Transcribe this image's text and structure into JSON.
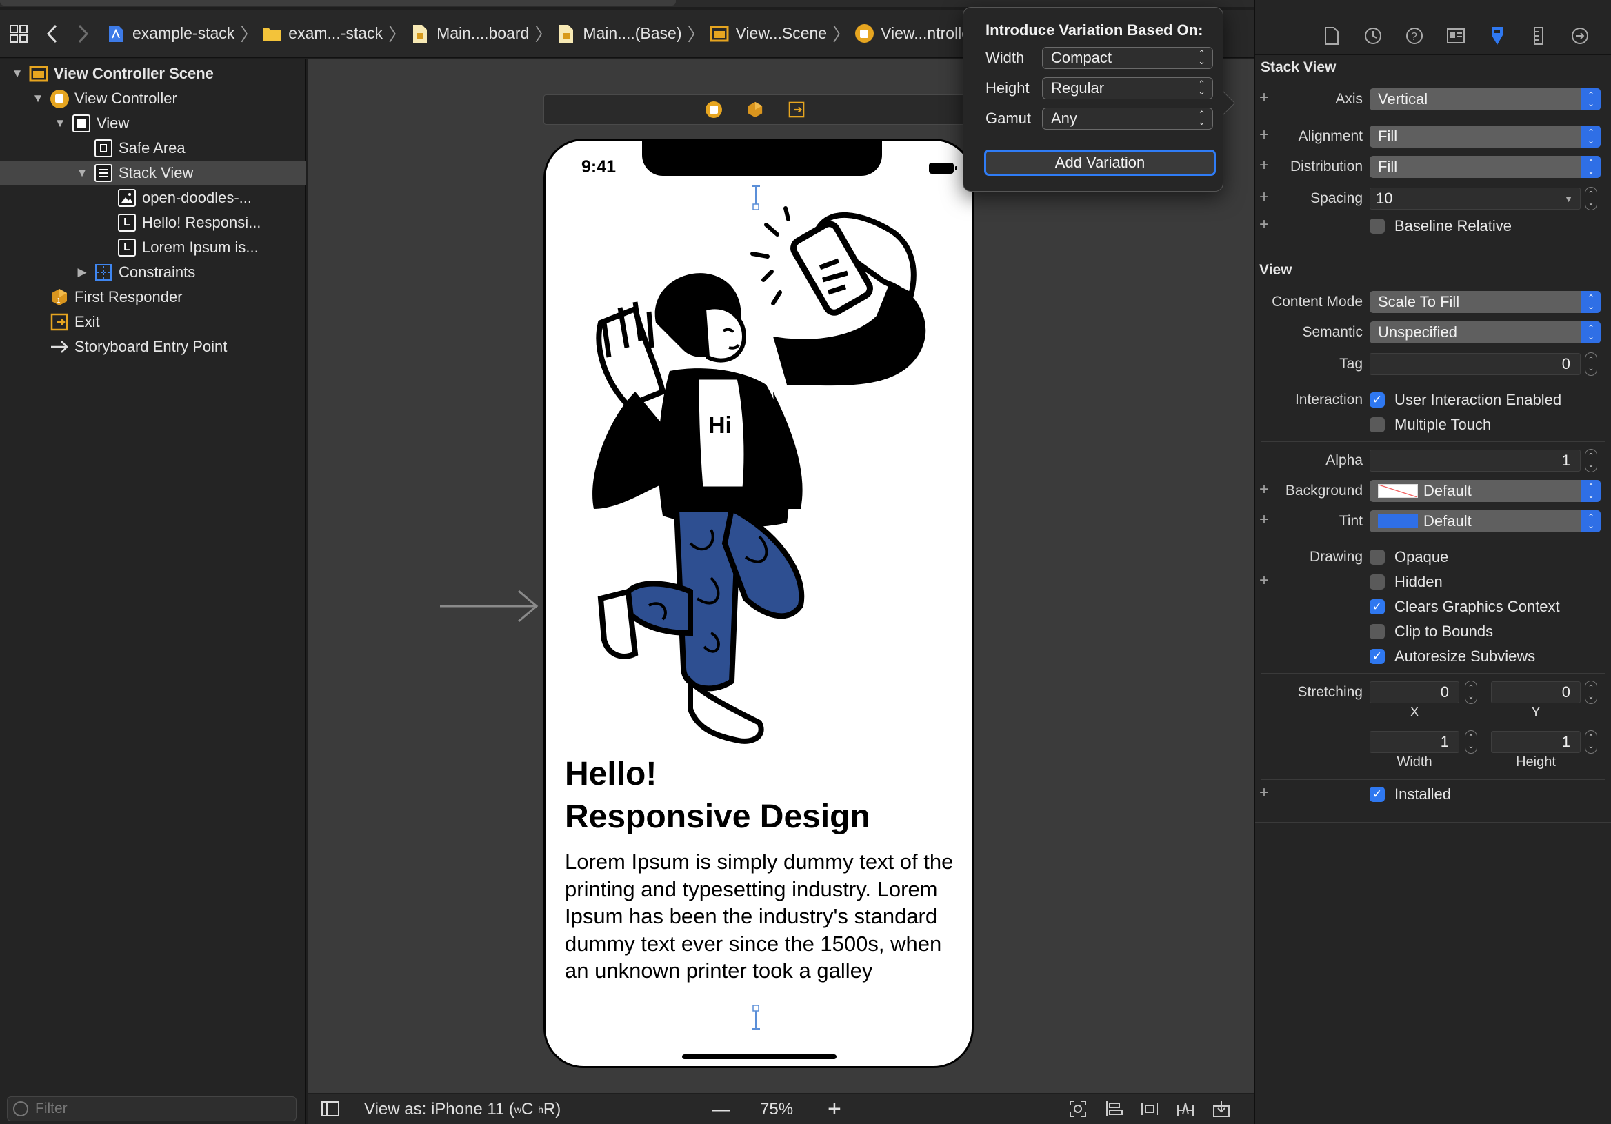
{
  "jumpbar": {
    "crumbs": [
      "example-stack",
      "exam...-stack",
      "Main....board",
      "Main....(Base)",
      "View...Scene",
      "View...ntroller"
    ]
  },
  "navigator": {
    "rows": [
      {
        "label": "View Controller Scene",
        "icon": "scene-icon"
      },
      {
        "label": "View Controller",
        "icon": "view-controller-icon"
      },
      {
        "label": "View",
        "icon": "view-icon"
      },
      {
        "label": "Safe Area",
        "icon": "safe-area-icon"
      },
      {
        "label": "Stack View",
        "icon": "stack-view-icon"
      },
      {
        "label": "open-doodles-...",
        "icon": "image-view-icon"
      },
      {
        "label": "Hello! Responsi...",
        "icon": "label-icon"
      },
      {
        "label": "Lorem Ipsum is...",
        "icon": "label-icon"
      },
      {
        "label": "Constraints",
        "icon": "constraints-icon"
      },
      {
        "label": "First Responder",
        "icon": "first-responder-icon"
      },
      {
        "label": "Exit",
        "icon": "exit-icon"
      },
      {
        "label": "Storyboard Entry Point",
        "icon": "arrow-right-icon"
      }
    ],
    "label_glyph": "L",
    "filter_placeholder": "Filter"
  },
  "phone": {
    "time": "9:41",
    "shirt_text": "Hi",
    "title_line1": "Hello!",
    "title_line2": "Responsive Design",
    "body": "Lorem Ipsum is simply dummy text of the printing and typesetting industry. Lorem Ipsum has been the industry's standard dummy text ever since the 1500s, when an unknown printer took a galley"
  },
  "canvas_bottom": {
    "view_as_prefix": "View as: iPhone 11 (",
    "size_w": "w",
    "size_w_value": "C",
    "size_h": "h",
    "size_h_value": "R",
    "view_as_suffix": ")",
    "zoom": "75%",
    "minus": "—",
    "plus": "+"
  },
  "popover": {
    "title": "Introduce Variation Based On:",
    "width_label": "Width",
    "width_value": "Compact",
    "height_label": "Height",
    "height_value": "Regular",
    "gamut_label": "Gamut",
    "gamut_value": "Any",
    "add_button": "Add Variation"
  },
  "inspector": {
    "stack_view_title": "Stack View",
    "axis_label": "Axis",
    "axis_value": "Vertical",
    "alignment_label": "Alignment",
    "alignment_value": "Fill",
    "distribution_label": "Distribution",
    "distribution_value": "Fill",
    "spacing_label": "Spacing",
    "spacing_value": "10",
    "baseline_relative": "Baseline Relative",
    "view_title": "View",
    "content_mode_label": "Content Mode",
    "content_mode_value": "Scale To Fill",
    "semantic_label": "Semantic",
    "semantic_value": "Unspecified",
    "tag_label": "Tag",
    "tag_value": "0",
    "interaction_label": "Interaction",
    "user_interaction": "User Interaction Enabled",
    "multiple_touch": "Multiple Touch",
    "alpha_label": "Alpha",
    "alpha_value": "1",
    "background_label": "Background",
    "background_value": "Default",
    "tint_label": "Tint",
    "tint_value": "Default",
    "drawing_label": "Drawing",
    "opaque": "Opaque",
    "hidden": "Hidden",
    "clears_graphics": "Clears Graphics Context",
    "clip_to_bounds": "Clip to Bounds",
    "autoresize": "Autoresize Subviews",
    "stretching_label": "Stretching",
    "stretch_x_value": "0",
    "stretch_y_value": "0",
    "stretch_w_value": "1",
    "stretch_h_value": "1",
    "x_label": "X",
    "y_label": "Y",
    "width_sub": "Width",
    "height_sub": "Height",
    "installed": "Installed",
    "checkmark": "✓",
    "plus": "+"
  },
  "colors": {
    "accent_blue": "#2f78f0",
    "scene_yellow": "#e6a520",
    "pants_blue": "#2e4f91",
    "tint_blue": "#2f6fe6"
  }
}
